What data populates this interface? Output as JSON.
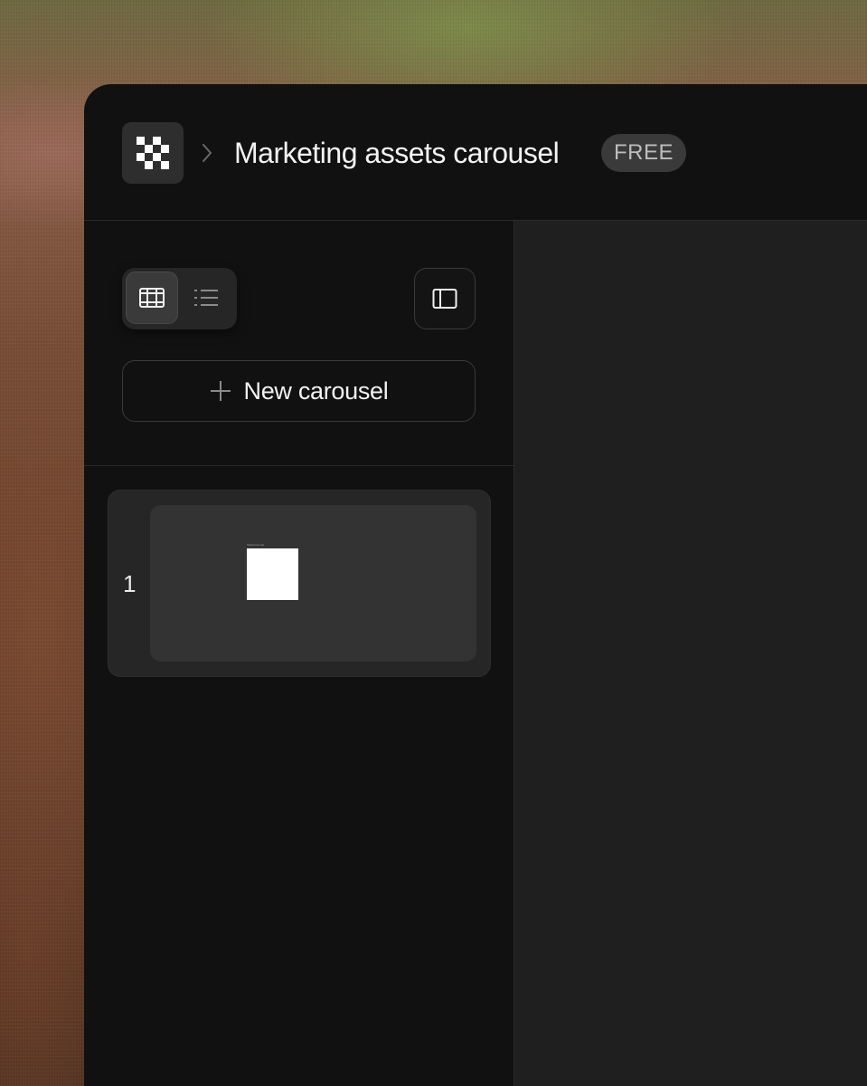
{
  "header": {
    "project_title": "Marketing assets carousel",
    "plan_badge": "FREE"
  },
  "icons": {
    "logo": "checkerboard-logo-icon",
    "breadcrumb_separator": "chevron-right-icon",
    "grid_view": "film-strip-icon",
    "list_view": "list-icon",
    "panel_toggle": "sidebar-panel-icon",
    "add": "plus-icon"
  },
  "sidebar": {
    "view_mode_selected": "grid",
    "new_carousel_label": "New carousel",
    "slides": [
      {
        "number": "1",
        "thumbnail_caption": "Slideshow title"
      }
    ]
  },
  "colors": {
    "window_bg": "#111111",
    "canvas_bg": "#1f1f1f",
    "badge_bg": "#3a3a3a",
    "text_primary": "#f2f2f2"
  }
}
